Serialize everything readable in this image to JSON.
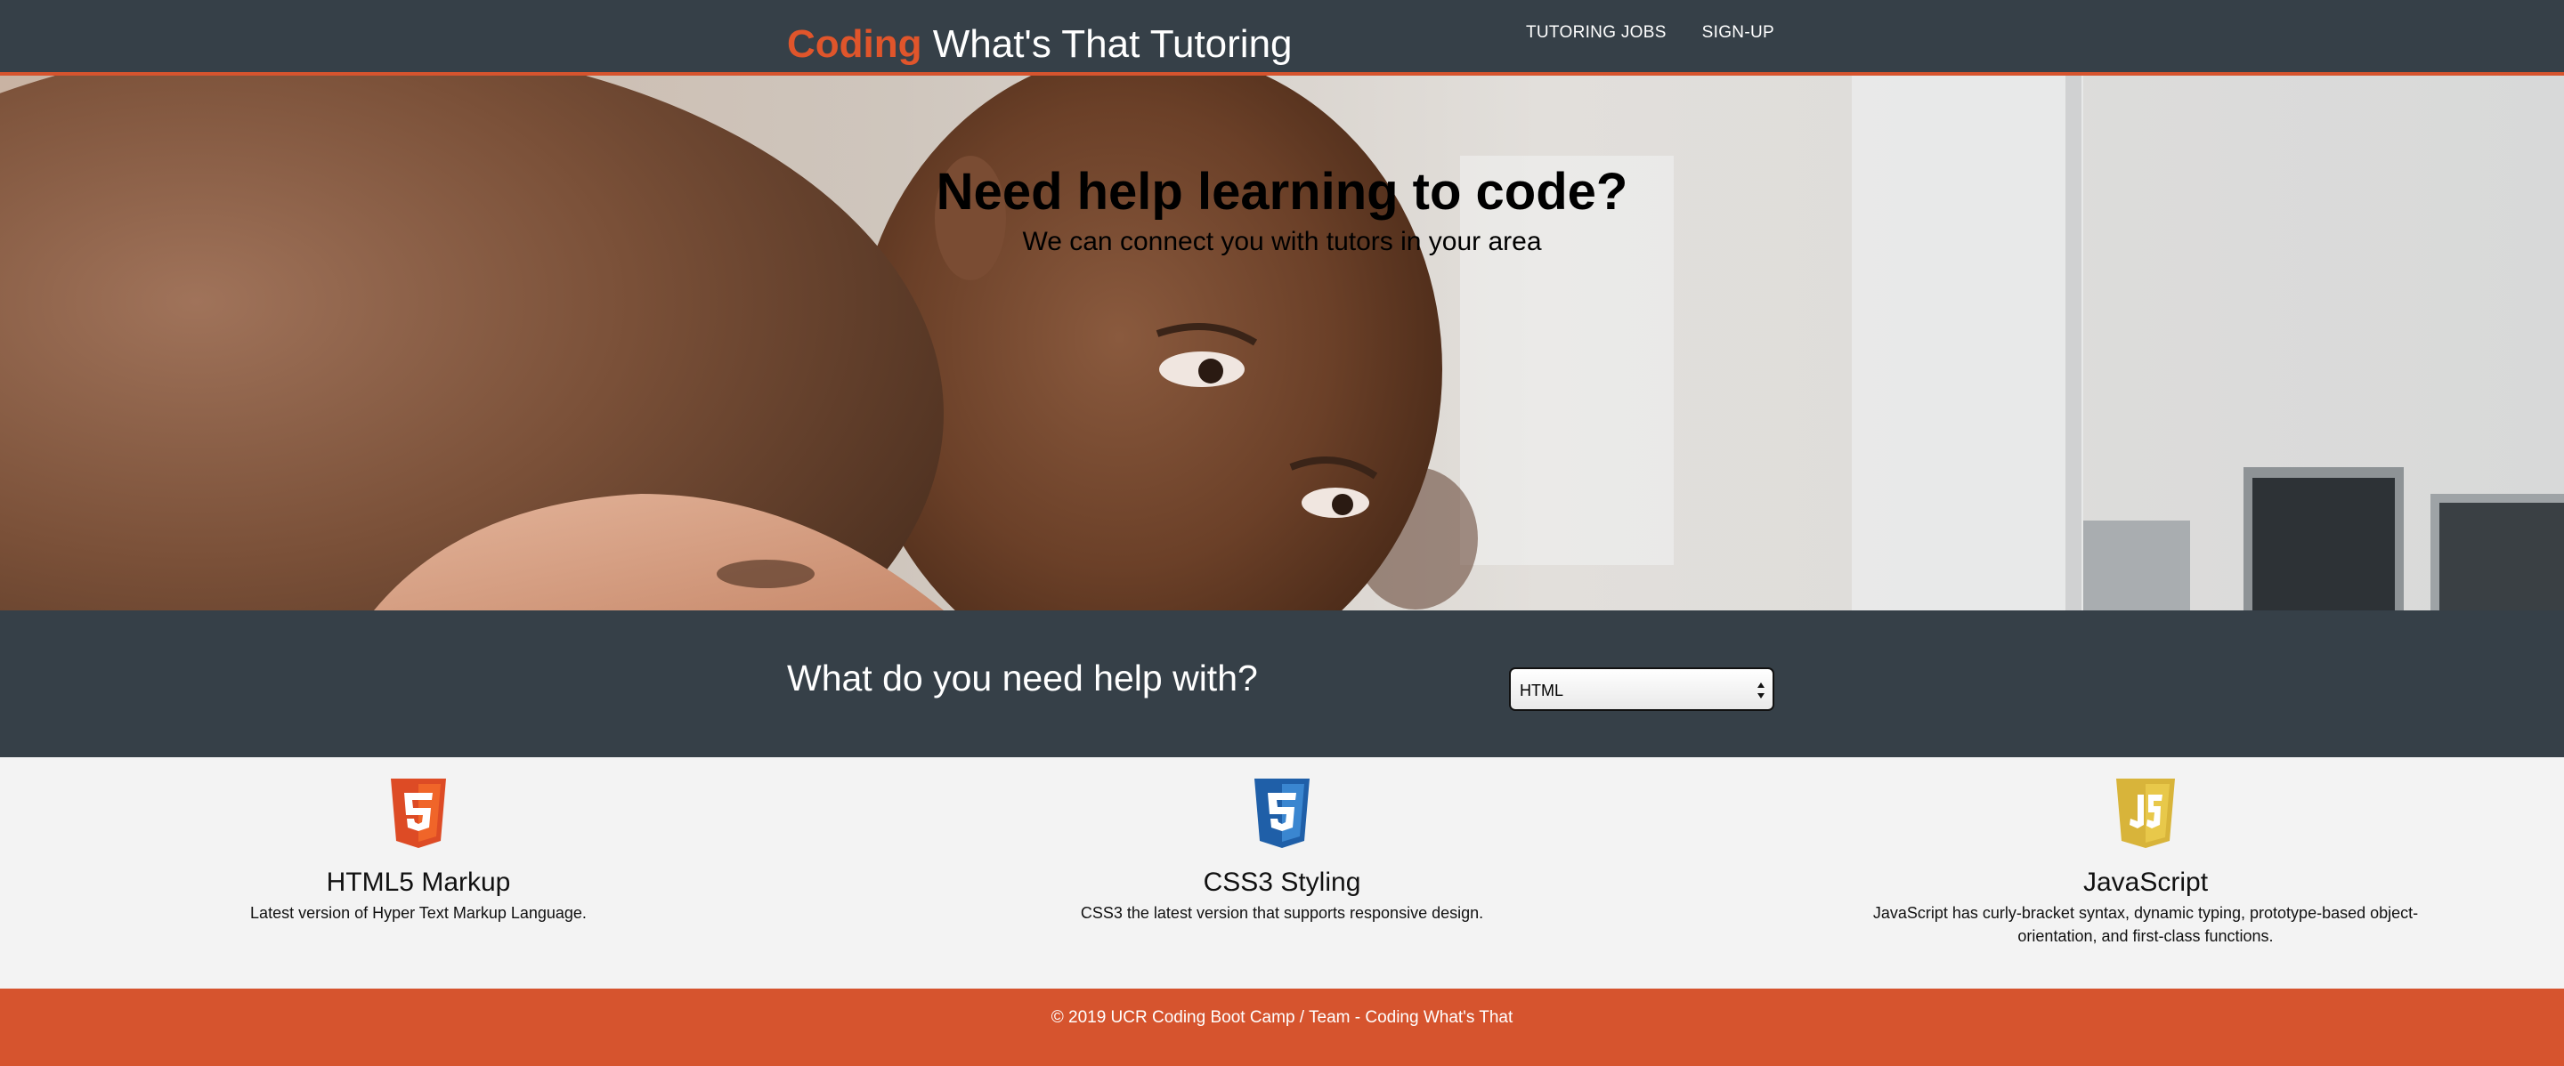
{
  "brand": {
    "accent": "Coding",
    "rest": " What's That Tutoring",
    "accent_color": "#e0552b"
  },
  "nav": {
    "items": [
      {
        "label": "TUTORING JOBS"
      },
      {
        "label": "SIGN-UP"
      }
    ]
  },
  "hero": {
    "title": "Need help learning to code?",
    "subtitle": "We can connect you with tutors in your area"
  },
  "help": {
    "title": "What do you need help with?",
    "select": {
      "selected": "HTML"
    }
  },
  "features": [
    {
      "icon": "html5-logo-icon",
      "title": "HTML5 Markup",
      "description": "Latest version of Hyper Text Markup Language.",
      "color": "#dd4b25"
    },
    {
      "icon": "css3-logo-icon",
      "title": "CSS3 Styling",
      "description": "CSS3 the latest version that supports responsive design.",
      "color": "#2d6db5"
    },
    {
      "icon": "javascript-logo-icon",
      "title": "JavaScript",
      "description": "JavaScript has curly-bracket syntax, dynamic typing, prototype-based object-orientation, and first-class functions.",
      "color": "#d8b43a"
    }
  ],
  "footer": {
    "text": "© 2019 UCR Coding Boot Camp / Team - Coding What's That"
  },
  "colors": {
    "header_bg": "#364048",
    "accent": "#d6542e",
    "page_bg": "#f3f3f3"
  }
}
